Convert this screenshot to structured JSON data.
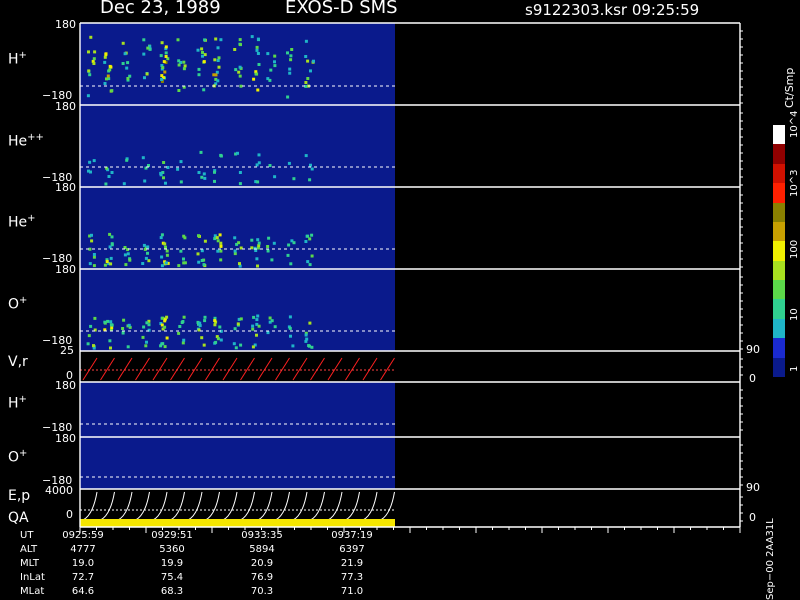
{
  "header": {
    "date": "Dec 23, 1989",
    "instrument": "EXOS-D SMS",
    "file_time": "s9122303.ksr  09:25:59"
  },
  "panels": [
    {
      "id": "h_plus",
      "label": "H",
      "sup": "+",
      "ytop": "180",
      "ybot": "−180",
      "kind": "spectrogram"
    },
    {
      "id": "he_pp",
      "label": "He",
      "sup": "++",
      "ytop": "180",
      "ybot": "−180",
      "kind": "spectrogram"
    },
    {
      "id": "he_plus",
      "label": "He",
      "sup": "+",
      "ytop": "180",
      "ybot": "−180",
      "kind": "spectrogram"
    },
    {
      "id": "o_plus",
      "label": "O",
      "sup": "+",
      "ytop": "180",
      "ybot": "−180",
      "kind": "spectrogram"
    },
    {
      "id": "vr",
      "label": "V,r",
      "sup": "",
      "ytop": "25",
      "ybot": "0",
      "rtop": "90",
      "rbot": "0",
      "kind": "line"
    },
    {
      "id": "h_plus2",
      "label": "H",
      "sup": "+",
      "ytop": "180",
      "ybot": "−180",
      "kind": "spectrogram-empty"
    },
    {
      "id": "o_plus2",
      "label": "O",
      "sup": "+",
      "ytop": "180",
      "ybot": "−180",
      "kind": "spectrogram-empty"
    },
    {
      "id": "ep",
      "label": "E,p",
      "sup": "",
      "ytop": "4000",
      "ybot": "0",
      "rtop": "90",
      "rbot": "0",
      "kind": "line"
    }
  ],
  "qa_label": "QA",
  "colorbar": {
    "unit": "Ct/Smp",
    "ticks": [
      "1",
      "10",
      "100",
      "10^3",
      "10^4"
    ],
    "colors": [
      "#0a1a8c",
      "#1a2ad0",
      "#1fb5c8",
      "#30d090",
      "#5cd84a",
      "#a8e020",
      "#f0f000",
      "#c8a000",
      "#8a8000",
      "#ff2000",
      "#d01000",
      "#900000",
      "#ffffff"
    ]
  },
  "footer": {
    "rows": [
      {
        "name": "UT",
        "values": [
          "0925:59",
          "0929:51",
          "0933:35",
          "0937:19"
        ]
      },
      {
        "name": "ALT",
        "values": [
          "4777",
          "5360",
          "5894",
          "6397"
        ]
      },
      {
        "name": "MLT",
        "values": [
          "19.0",
          "19.9",
          "20.9",
          "21.9"
        ]
      },
      {
        "name": "InLat",
        "values": [
          "72.7",
          "75.4",
          "76.9",
          "77.3"
        ]
      },
      {
        "name": "MLat",
        "values": [
          "64.6",
          "68.3",
          "70.3",
          "71.0"
        ]
      }
    ],
    "stamp": "Sep−00  2AA31L"
  },
  "chart_data": {
    "type": "heatmap",
    "title": "Dec 23, 1989   EXOS-D SMS",
    "x": [
      "0925:59",
      "0929:51",
      "0933:35",
      "0937:19"
    ],
    "series": [
      {
        "name": "H+",
        "ylim": [
          -180,
          180
        ]
      },
      {
        "name": "He++",
        "ylim": [
          -180,
          180
        ]
      },
      {
        "name": "He+",
        "ylim": [
          -180,
          180
        ]
      },
      {
        "name": "O+",
        "ylim": [
          -180,
          180
        ]
      },
      {
        "name": "V,r",
        "ylim": [
          0,
          25
        ],
        "right_ylim": [
          0,
          90
        ]
      },
      {
        "name": "H+",
        "ylim": [
          -180,
          180
        ]
      },
      {
        "name": "O+",
        "ylim": [
          -180,
          180
        ]
      },
      {
        "name": "E,p",
        "ylim": [
          0,
          4000
        ],
        "right_ylim": [
          0,
          90
        ]
      }
    ],
    "colorscale": {
      "label": "Ct/Smp",
      "log": true,
      "range": [
        1,
        10000
      ]
    }
  }
}
